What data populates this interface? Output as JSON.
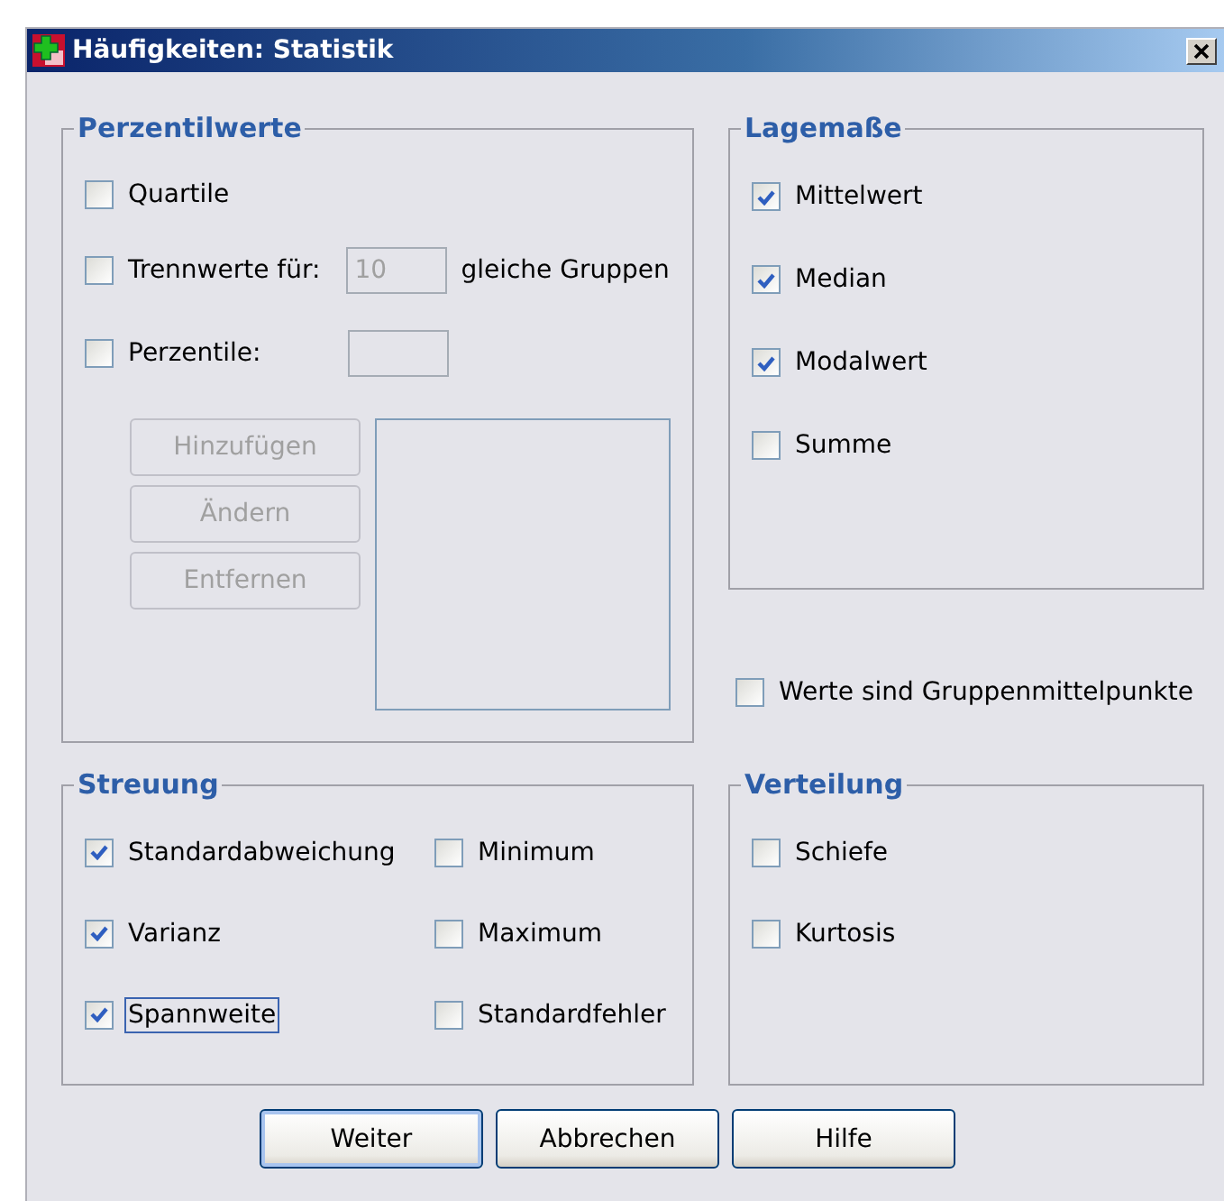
{
  "window": {
    "title": "Häufigkeiten: Statistik"
  },
  "percentile_values": {
    "title": "Perzentilwerte",
    "quartiles": {
      "label": "Quartile",
      "checked": false
    },
    "cut_points": {
      "label": "Trennwerte für:",
      "checked": false,
      "value": "10",
      "disabled": true,
      "suffix": "gleiche Gruppen"
    },
    "percentiles": {
      "label": "Perzentile:",
      "checked": false,
      "disabled": true
    },
    "buttons": [
      {
        "label": "Hinzufügen",
        "disabled": true
      },
      {
        "label": "Ändern",
        "disabled": true
      },
      {
        "label": "Entfernen",
        "disabled": true
      }
    ]
  },
  "central_tendency": {
    "title": "Lagemaße",
    "items": [
      {
        "label": "Mittelwert",
        "checked": true
      },
      {
        "label": "Median",
        "checked": true
      },
      {
        "label": "Modalwert",
        "checked": true
      },
      {
        "label": "Summe",
        "checked": false
      }
    ]
  },
  "group_midpoints": {
    "label": "Werte sind Gruppenmittelpunkte",
    "checked": false
  },
  "dispersion": {
    "title": "Streuung",
    "items": [
      {
        "label": "Standardabweichung",
        "checked": true,
        "focused": false
      },
      {
        "label": "Minimum",
        "checked": false,
        "focused": false
      },
      {
        "label": "Varianz",
        "checked": true,
        "focused": false
      },
      {
        "label": "Maximum",
        "checked": false,
        "focused": false
      },
      {
        "label": "Spannweite",
        "checked": true,
        "focused": true
      },
      {
        "label": "Standardfehler",
        "checked": false,
        "focused": false
      }
    ]
  },
  "distribution": {
    "title": "Verteilung",
    "items": [
      {
        "label": "Schiefe",
        "checked": false
      },
      {
        "label": "Kurtosis",
        "checked": false
      }
    ]
  },
  "buttons": [
    {
      "label": "Weiter",
      "default": true
    },
    {
      "label": "Abbrechen",
      "default": false
    },
    {
      "label": "Hilfe",
      "default": false
    }
  ]
}
